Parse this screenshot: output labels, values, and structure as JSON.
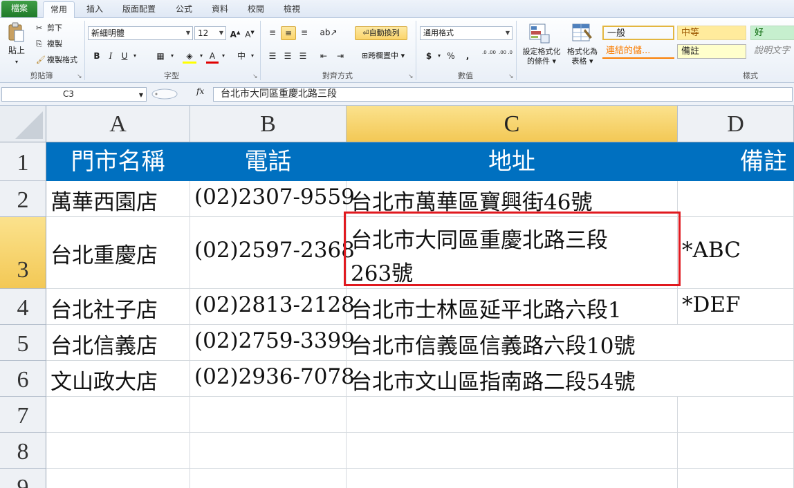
{
  "tabs": {
    "file": "檔案",
    "home": "常用",
    "insert": "插入",
    "layout": "版面配置",
    "formulas": "公式",
    "data": "資料",
    "review": "校閱",
    "view": "檢視"
  },
  "ribbon": {
    "clipboard": {
      "paste": "貼上",
      "cut": "剪下",
      "copy": "複製",
      "format_painter": "複製格式",
      "label": "剪貼簿"
    },
    "font": {
      "name": "新細明體",
      "size": "12",
      "bold": "B",
      "italic": "I",
      "underline": "U",
      "phonetic": "中",
      "label": "字型"
    },
    "alignment": {
      "wrap_text": "自動換列",
      "merge_center": "跨欄置中",
      "label": "對齊方式"
    },
    "number": {
      "format": "通用格式",
      "currency": "$",
      "percent": "%",
      "comma": ",",
      "inc_decimal": ".0 .00",
      "dec_decimal": ".00 .0",
      "label": "數值"
    },
    "styles": {
      "conditional": [
        "設定格式化",
        "的條件"
      ],
      "as_table": [
        "格式化為",
        "表格"
      ],
      "cells": [
        {
          "text": "一般",
          "bg": "#ffffff",
          "color": "#000000"
        },
        {
          "text": "中等",
          "bg": "#ffeb9c",
          "color": "#9c5700"
        },
        {
          "text": "好",
          "bg": "#c6efce",
          "color": "#006100"
        },
        {
          "text": "連結的儲...",
          "bg": "#ffffff",
          "color": "#fa7d00"
        },
        {
          "text": "備註",
          "bg": "#ffffcc",
          "color": "#000000"
        },
        {
          "text": "說明文字",
          "bg": "#ffffff",
          "color": "#7f7f7f"
        }
      ],
      "label": "樣式"
    }
  },
  "formula_bar": {
    "name_box": "C3",
    "fx": "fx",
    "content": "台北市大同區重慶北路三段"
  },
  "sheet": {
    "columns": [
      "A",
      "B",
      "C",
      "D"
    ],
    "selected_column": "C",
    "rows": [
      "1",
      "2",
      "3",
      "4",
      "5",
      "6",
      "7",
      "8",
      "9"
    ],
    "selected_row": "3",
    "header_row": [
      "門市名稱",
      "電話",
      "地址",
      "備註"
    ],
    "data": [
      [
        "萬華西園店",
        "(02)2307-9559",
        "台北市萬華區寶興街46號",
        ""
      ],
      [
        "台北重慶店",
        "(02)2597-2368",
        "台北市大同區重慶北路三段",
        "*ABC"
      ],
      [
        "台北社子店",
        "(02)2813-2128",
        "台北市士林區延平北路六段1",
        "*DEF"
      ],
      [
        "台北信義店",
        "(02)2759-3399",
        "台北市信義區信義路六段10號",
        ""
      ],
      [
        "文山政大店",
        "(02)2936-7078",
        "台北市文山區指南路二段54號",
        ""
      ]
    ],
    "c3_second_line": "263號",
    "header_fill": "#0070c0",
    "selection_color": "#e0191f"
  }
}
